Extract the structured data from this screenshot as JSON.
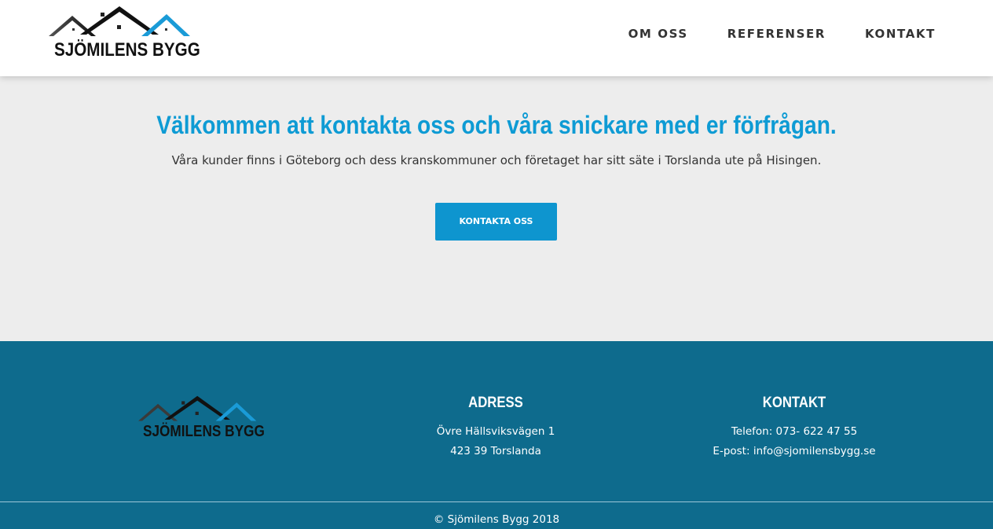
{
  "brand": {
    "name": "SJÖMILENS BYGG",
    "colors": {
      "accent": "#0e9bd4",
      "footer": "#0e6b8d",
      "roof_dark": "#222222",
      "roof_blue": "#1a9bd7"
    }
  },
  "header": {
    "nav": [
      {
        "label": "OM OSS"
      },
      {
        "label": "REFERENSER"
      },
      {
        "label": "KONTAKT"
      }
    ]
  },
  "hero": {
    "title": "Välkommen att kontakta oss och våra snickare med er förfrågan.",
    "subtitle": "Våra kunder finns i Göteborg och dess kranskommuner och företaget har sitt säte i Torslanda ute på Hisingen.",
    "cta_label": "KONTAKTA OSS"
  },
  "footer": {
    "address": {
      "title": "ADRESS",
      "line1": "Övre Hällsviksvägen 1",
      "line2": "423 39 Torslanda"
    },
    "contact": {
      "title": "KONTAKT",
      "phone": "Telefon: 073- 622 47 55",
      "email": "E-post: info@sjomilensbygg.se"
    },
    "copyright": "© Sjömilens Bygg 2018"
  }
}
